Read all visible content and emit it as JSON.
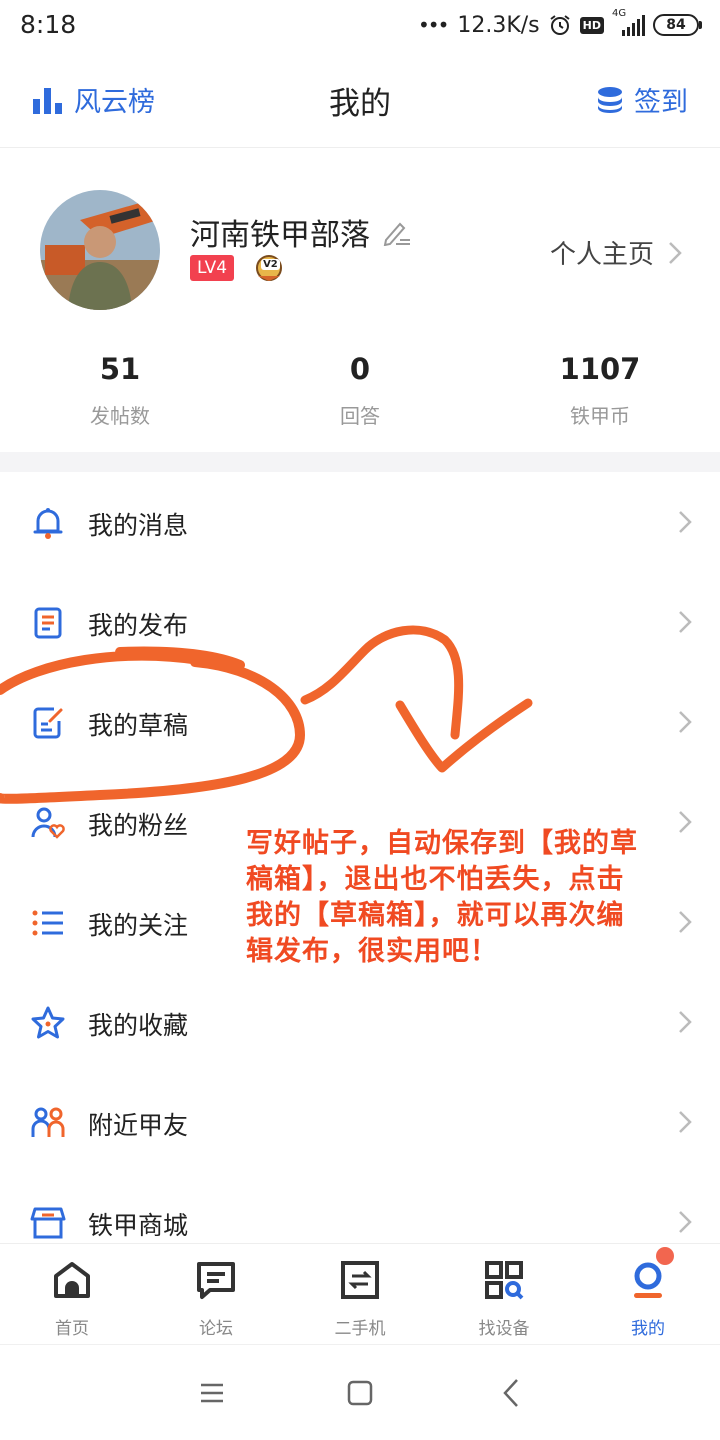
{
  "status_bar": {
    "time": "8:18",
    "network_speed": "12.3K/s",
    "hd": "HD",
    "signal_type": "4G",
    "battery": "84"
  },
  "header": {
    "left_label": "风云榜",
    "title": "我的",
    "right_label": "签到"
  },
  "profile": {
    "username": "河南铁甲部落",
    "level": "LV4",
    "badge": "V2",
    "home_link": "个人主页",
    "stats": [
      {
        "value": "51",
        "label": "发帖数"
      },
      {
        "value": "0",
        "label": "回答"
      },
      {
        "value": "1107",
        "label": "铁甲币"
      }
    ]
  },
  "menu": {
    "items": [
      {
        "label": "我的消息",
        "icon": "bell-icon"
      },
      {
        "label": "我的发布",
        "icon": "document-icon"
      },
      {
        "label": "我的草稿",
        "icon": "edit-draft-icon"
      },
      {
        "label": "我的粉丝",
        "icon": "user-heart-icon"
      },
      {
        "label": "我的关注",
        "icon": "list-icon"
      },
      {
        "label": "我的收藏",
        "icon": "star-icon"
      },
      {
        "label": "附近甲友",
        "icon": "people-icon"
      },
      {
        "label": "铁甲商城",
        "icon": "shop-icon"
      }
    ]
  },
  "annotation": {
    "lines": [
      "写好帖子，自动保存到【我的草",
      "稿箱】，退出也不怕丢失，点击",
      "我的【草稿箱】，就可以再次编",
      "辑发布，很实用吧！"
    ],
    "color": "#f04a22"
  },
  "tabbar": {
    "tabs": [
      {
        "label": "首页",
        "icon": "home-icon"
      },
      {
        "label": "论坛",
        "icon": "chat-icon"
      },
      {
        "label": "二手机",
        "icon": "machine-icon"
      },
      {
        "label": "找设备",
        "icon": "scan-icon"
      },
      {
        "label": "我的",
        "icon": "profile-icon",
        "active": true
      }
    ]
  },
  "colors": {
    "accent": "#2f6bdc",
    "orange": "#f0652c",
    "level_badge": "#f2414f"
  }
}
